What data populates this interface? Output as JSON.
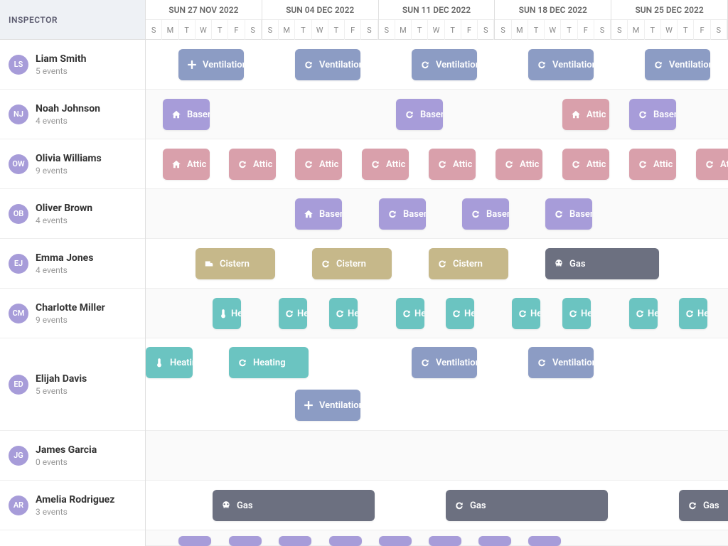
{
  "sidebar_header": "INSPECTOR",
  "weeks": [
    {
      "label": "SUN 27 NOV 2022"
    },
    {
      "label": "SUN 04 DEC 2022"
    },
    {
      "label": "SUN 11 DEC 2022"
    },
    {
      "label": "SUN 18 DEC 2022"
    },
    {
      "label": "SUN 25 DEC 2022"
    }
  ],
  "day_letters": [
    "S",
    "M",
    "T",
    "W",
    "T",
    "F",
    "S"
  ],
  "inspectors": [
    {
      "initials": "LS",
      "name": "Liam Smith",
      "count": "5 events"
    },
    {
      "initials": "NJ",
      "name": "Noah Johnson",
      "count": "4 events"
    },
    {
      "initials": "OW",
      "name": "Olivia Williams",
      "count": "9 events"
    },
    {
      "initials": "OB",
      "name": "Oliver Brown",
      "count": "4 events"
    },
    {
      "initials": "EJ",
      "name": "Emma Jones",
      "count": "4 events"
    },
    {
      "initials": "CM",
      "name": "Charlotte Miller",
      "count": "9 events"
    },
    {
      "initials": "ED",
      "name": "Elijah Davis",
      "count": "5 events"
    },
    {
      "initials": "JG",
      "name": "James Garcia",
      "count": "0 events"
    },
    {
      "initials": "AR",
      "name": "Amelia Rodriguez",
      "count": "3 events"
    }
  ],
  "labels": {
    "ventilation": "Ventilation",
    "basement": "Basement",
    "attic": "Attic",
    "cistern": "Cistern",
    "gas": "Gas",
    "heating": "Heating",
    "h_short": "Heating",
    "atext": "Attic"
  },
  "icons": {
    "plus": "plus-icon",
    "refresh": "refresh-icon",
    "home": "home-icon",
    "pump": "pump-icon",
    "skull": "skull-icon",
    "thermo": "thermometer-icon"
  }
}
